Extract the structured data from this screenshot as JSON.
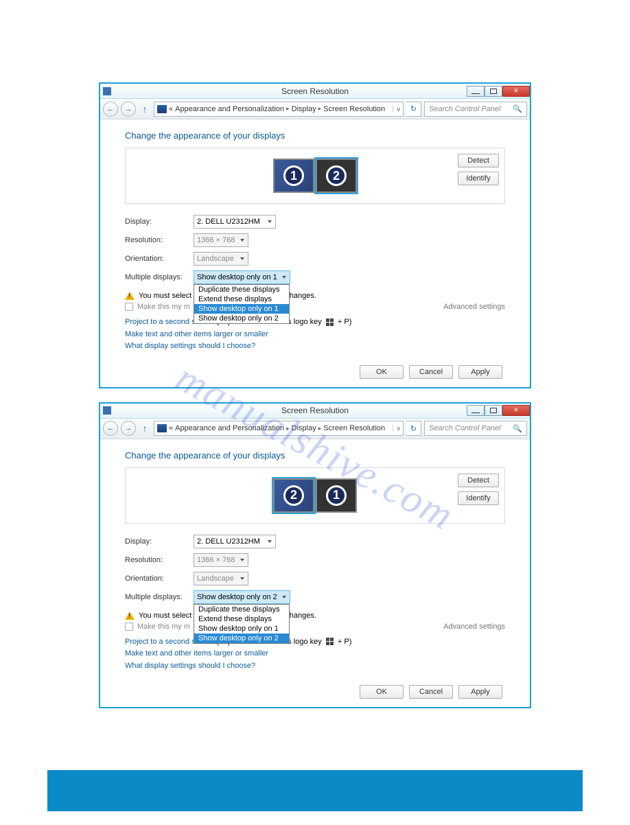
{
  "watermark": "manualshive.com",
  "window1": {
    "title": "Screen Resolution",
    "breadcrumb": {
      "chev": "«",
      "a": "Appearance and Personalization",
      "b": "Display",
      "c": "Screen Resolution"
    },
    "search_placeholder": "Search Control Panel",
    "heading": "Change the appearance of your displays",
    "detect": "Detect",
    "identify": "Identify",
    "monitors": {
      "left_num": "1",
      "right_num": "2"
    },
    "labels": {
      "display": "Display:",
      "resolution": "Resolution:",
      "orientation": "Orientation:",
      "multiple": "Multiple displays:"
    },
    "values": {
      "display": "2. DELL U2312HM",
      "resolution": "1366 × 768",
      "orientation": "Landscape",
      "multiple": "Show desktop only on 1"
    },
    "dropdown": {
      "opt1": "Duplicate these displays",
      "opt2": "Extend these displays",
      "opt3": "Show desktop only on 1",
      "opt4": "Show desktop only on 2",
      "selected_index": 2
    },
    "warning": "You must select ...onal changes.",
    "maindisplay": "Make this my m",
    "advanced": "Advanced settings",
    "project_link": "Project to a second screen",
    "project_rest": " (or press the Windows logo key ",
    "project_end": " + P)",
    "link2": "Make text and other items larger or smaller",
    "link3": "What display settings should I choose?",
    "ok": "OK",
    "cancel": "Cancel",
    "apply": "Apply"
  },
  "window2": {
    "title": "Screen Resolution",
    "breadcrumb": {
      "chev": "«",
      "a": "Appearance and Personalization",
      "b": "Display",
      "c": "Screen Resolution"
    },
    "search_placeholder": "Search Control Panel",
    "heading": "Change the appearance of your displays",
    "detect": "Detect",
    "identify": "Identify",
    "monitors": {
      "left_num": "2",
      "right_num": "1"
    },
    "labels": {
      "display": "Display:",
      "resolution": "Resolution:",
      "orientation": "Orientation:",
      "multiple": "Multiple displays:"
    },
    "values": {
      "display": "2. DELL U2312HM",
      "resolution": "1366 × 768",
      "orientation": "Landscape",
      "multiple": "Show desktop only on 2"
    },
    "dropdown": {
      "opt1": "Duplicate these displays",
      "opt2": "Extend these displays",
      "opt3": "Show desktop only on 1",
      "opt4": "Show desktop only on 2",
      "selected_index": 3
    },
    "warning": "You must select ...onal changes.",
    "maindisplay": "Make this my m",
    "advanced": "Advanced settings",
    "project_link": "Project to a second screen",
    "project_rest": " (or press the Windows logo key ",
    "project_end": " + P)",
    "link2": "Make text and other items larger or smaller",
    "link3": "What display settings should I choose?",
    "ok": "OK",
    "cancel": "Cancel",
    "apply": "Apply"
  }
}
